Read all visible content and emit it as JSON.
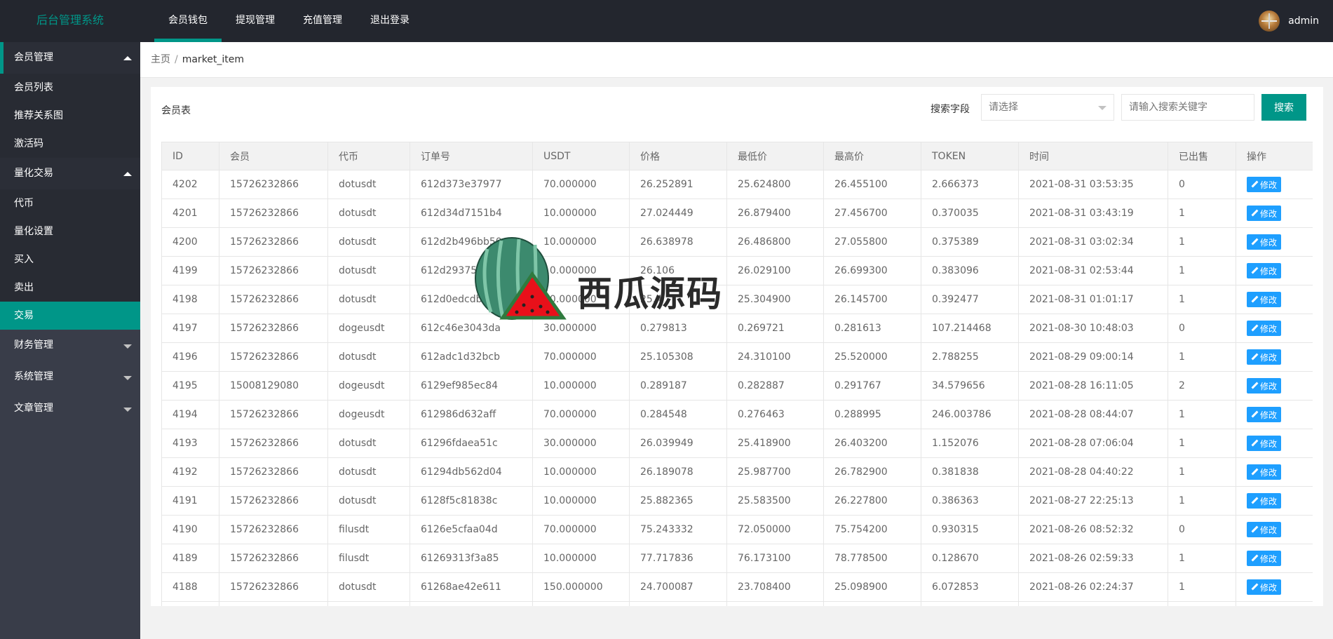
{
  "header": {
    "logo": "后台管理系统",
    "nav": [
      {
        "label": "会员钱包",
        "active": true
      },
      {
        "label": "提现管理",
        "active": false
      },
      {
        "label": "充值管理",
        "active": false
      },
      {
        "label": "退出登录",
        "active": false
      }
    ],
    "username": "admin"
  },
  "sidebar": {
    "groups": [
      {
        "title": "会员管理",
        "open": true,
        "items": [
          "会员列表",
          "推荐关系图",
          "激活码"
        ]
      },
      {
        "title": "量化交易",
        "open": true,
        "items": [
          "代币",
          "量化设置",
          "买入",
          "卖出",
          "交易"
        ],
        "active_item": "交易"
      },
      {
        "title": "财务管理",
        "open": false,
        "items": []
      },
      {
        "title": "系统管理",
        "open": false,
        "items": []
      },
      {
        "title": "文章管理",
        "open": false,
        "items": []
      }
    ]
  },
  "breadcrumb": {
    "home": "主页",
    "separator": "/",
    "current": "market_item"
  },
  "card": {
    "title": "会员表",
    "search": {
      "label": "搜索字段",
      "select_placeholder": "请选择",
      "input_placeholder": "请输入搜索关键字",
      "button": "搜索"
    }
  },
  "table": {
    "columns": [
      "ID",
      "会员",
      "代币",
      "订单号",
      "USDT",
      "价格",
      "最低价",
      "最高价",
      "TOKEN",
      "时间",
      "已出售",
      "操作"
    ],
    "action_label": "修改",
    "rows": [
      [
        "4202",
        "15726232866",
        "dotusdt",
        "612d373e37977",
        "70.000000",
        "26.252891",
        "25.624800",
        "26.455100",
        "2.666373",
        "2021-08-31 03:53:35",
        "0"
      ],
      [
        "4201",
        "15726232866",
        "dotusdt",
        "612d34d7151b4",
        "10.000000",
        "27.024449",
        "26.879400",
        "27.456700",
        "0.370035",
        "2021-08-31 03:43:19",
        "1"
      ],
      [
        "4200",
        "15726232866",
        "dotusdt",
        "612d2b496bb50",
        "10.000000",
        "26.638978",
        "26.486800",
        "27.055800",
        "0.375389",
        "2021-08-31 03:02:34",
        "1"
      ],
      [
        "4199",
        "15726232866",
        "dotusdt",
        "612d29375",
        "10.000000",
        "26.106",
        "26.029100",
        "26.699300",
        "0.383096",
        "2021-08-31 02:53:44",
        "1"
      ],
      [
        "4198",
        "15726232866",
        "dotusdt",
        "612d0edcdb",
        "10.000000",
        "25.4",
        "25.304900",
        "26.145700",
        "0.392477",
        "2021-08-31 01:01:17",
        "1"
      ],
      [
        "4197",
        "15726232866",
        "dogeusdt",
        "612c46e3043da",
        "30.000000",
        "0.279813",
        "0.269721",
        "0.281613",
        "107.214468",
        "2021-08-30 10:48:03",
        "0"
      ],
      [
        "4196",
        "15726232866",
        "dotusdt",
        "612adc1d32bcb",
        "70.000000",
        "25.105308",
        "24.310100",
        "25.520000",
        "2.788255",
        "2021-08-29 09:00:14",
        "1"
      ],
      [
        "4195",
        "15008129080",
        "dogeusdt",
        "6129ef985ec84",
        "10.000000",
        "0.289187",
        "0.282887",
        "0.291767",
        "34.579656",
        "2021-08-28 16:11:05",
        "2"
      ],
      [
        "4194",
        "15726232866",
        "dogeusdt",
        "612986d632aff",
        "70.000000",
        "0.284548",
        "0.276463",
        "0.288995",
        "246.003786",
        "2021-08-28 08:44:07",
        "1"
      ],
      [
        "4193",
        "15726232866",
        "dotusdt",
        "61296fdaea51c",
        "30.000000",
        "26.039949",
        "25.418900",
        "26.403200",
        "1.152076",
        "2021-08-28 07:06:04",
        "1"
      ],
      [
        "4192",
        "15726232866",
        "dotusdt",
        "61294db562d04",
        "10.000000",
        "26.189078",
        "25.987700",
        "26.782900",
        "0.381838",
        "2021-08-28 04:40:22",
        "1"
      ],
      [
        "4191",
        "15726232866",
        "dotusdt",
        "6128f5c81838c",
        "10.000000",
        "25.882365",
        "25.583500",
        "26.227800",
        "0.386363",
        "2021-08-27 22:25:13",
        "1"
      ],
      [
        "4190",
        "15726232866",
        "filusdt",
        "6126e5cfaa04d",
        "70.000000",
        "75.243332",
        "72.050000",
        "75.754200",
        "0.930315",
        "2021-08-26 08:52:32",
        "0"
      ],
      [
        "4189",
        "15726232866",
        "filusdt",
        "61269313f3a85",
        "10.000000",
        "77.717836",
        "76.173100",
        "78.778500",
        "0.128670",
        "2021-08-26 02:59:33",
        "1"
      ],
      [
        "4188",
        "15726232866",
        "dotusdt",
        "61268ae42e611",
        "150.000000",
        "24.700087",
        "23.708400",
        "25.098900",
        "6.072853",
        "2021-08-26 02:24:37",
        "1"
      ],
      [
        "",
        "",
        "",
        "",
        "",
        "",
        "",
        "",
        "",
        "",
        ""
      ]
    ]
  },
  "watermark": {
    "text": "西瓜源码"
  },
  "colors": {
    "accent": "#009688",
    "header_bg": "#23262e",
    "sidebar_bg": "#393d49",
    "edit_button": "#1e9fff"
  }
}
